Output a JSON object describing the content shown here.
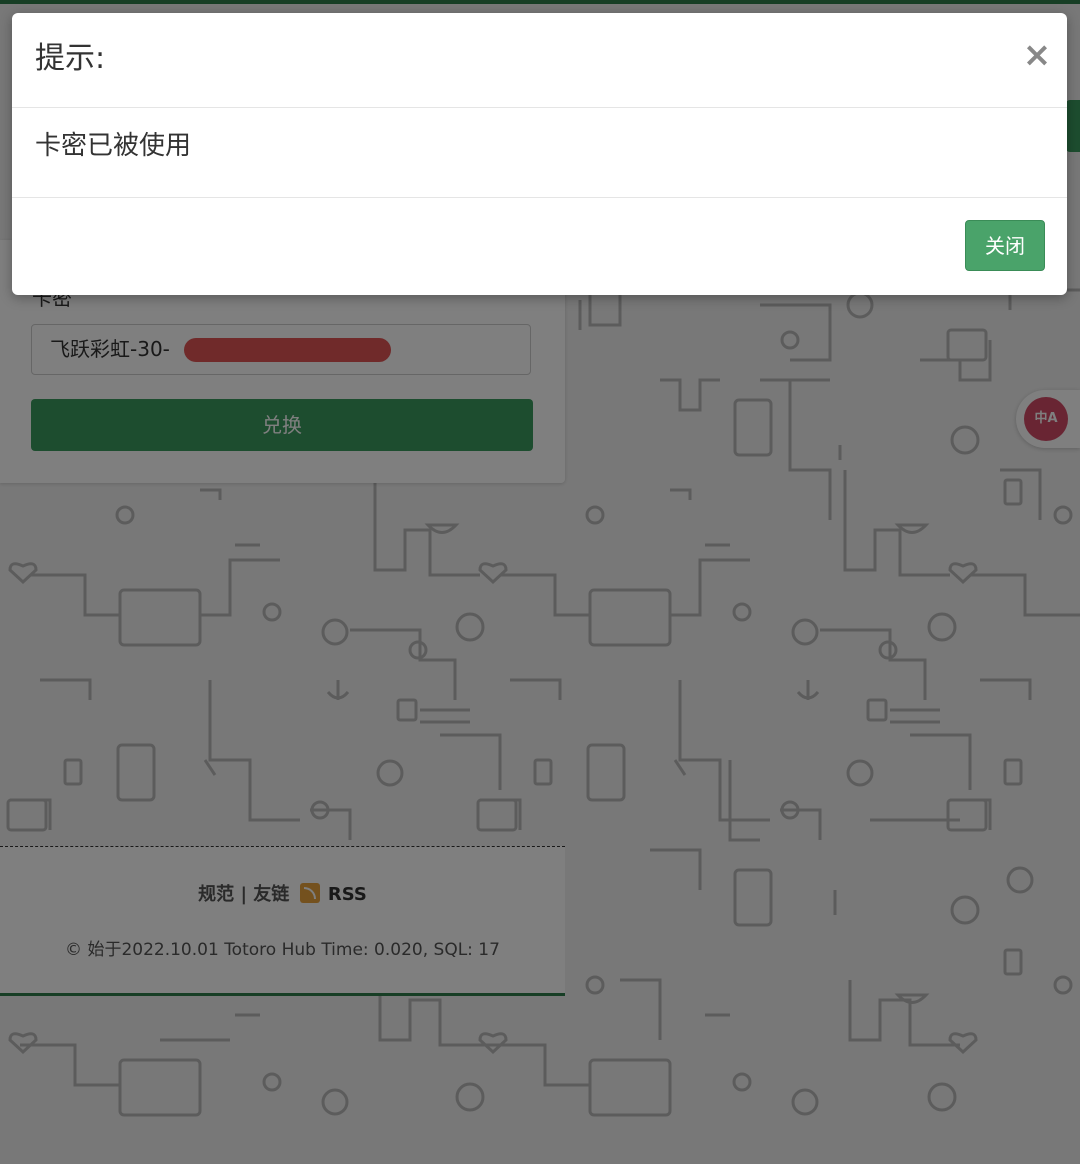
{
  "modal": {
    "title": "提示:",
    "close_icon": "close-icon",
    "message": "卡密已被使用",
    "button_label": "关闭"
  },
  "form": {
    "field_label": "卡密",
    "field_value": "飞跃彩虹-30-",
    "submit_label": "兑换"
  },
  "footer": {
    "link_rules": "规范",
    "separator": "|",
    "link_friends": "友链",
    "rss_label": "RSS",
    "rss_icon": "rss-icon",
    "copyright": "© 始于2022.10.01 Totoro Hub Time: 0.020, SQL: 17"
  },
  "floating": {
    "translate_icon": "translate-icon",
    "translate_text": "中A"
  },
  "colors": {
    "primary_green": "#3a9a5e",
    "dark_green": "#2e7d4a",
    "redaction": "#e05555",
    "translate_pink": "#d24a66"
  }
}
